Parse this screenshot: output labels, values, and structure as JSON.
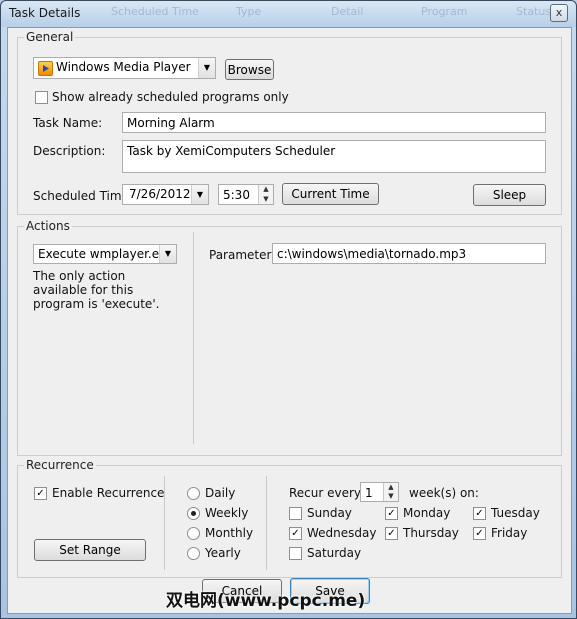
{
  "window": {
    "title": "Task Details",
    "close_glyph": "x",
    "ghost_headers": [
      "Scheduled Time",
      "Type",
      "Detail",
      "Program",
      "Status"
    ]
  },
  "general": {
    "label": "General",
    "program_select": "Windows Media Player",
    "program_icon": "media-player-icon",
    "browse_label": "Browse",
    "show_scheduled_label": "Show already scheduled programs only",
    "show_scheduled_checked": false,
    "task_name_label": "Task Name:",
    "task_name_value": "Morning Alarm",
    "description_label": "Description:",
    "description_value": "Task by XemiComputers Scheduler",
    "scheduled_time_label": "Scheduled Time:",
    "date_value": "7/26/2012",
    "time_value": "5:30",
    "current_time_label": "Current Time",
    "sleep_label": "Sleep"
  },
  "actions": {
    "label": "Actions",
    "action_select": "Execute wmplayer.exe",
    "note": "The only action available for this program is 'execute'.",
    "parameters_label": "Parameters:",
    "parameters_value": "c:\\windows\\media\\tornado.mp3"
  },
  "recurrence": {
    "label": "Recurrence",
    "enable_label": "Enable Recurrence",
    "enable_checked": true,
    "set_range_label": "Set Range",
    "options": [
      {
        "label": "Daily",
        "selected": false
      },
      {
        "label": "Weekly",
        "selected": true
      },
      {
        "label": "Monthly",
        "selected": false
      },
      {
        "label": "Yearly",
        "selected": false
      }
    ],
    "recur_every_label": "Recur every",
    "recur_every_value": "1",
    "weeks_on_label": "week(s) on:",
    "days": [
      {
        "label": "Sunday",
        "checked": false
      },
      {
        "label": "Monday",
        "checked": true
      },
      {
        "label": "Tuesday",
        "checked": true
      },
      {
        "label": "Wednesday",
        "checked": true
      },
      {
        "label": "Thursday",
        "checked": true
      },
      {
        "label": "Friday",
        "checked": true
      },
      {
        "label": "Saturday",
        "checked": false
      }
    ]
  },
  "footer": {
    "cancel_label": "Cancel",
    "save_label": "Save"
  },
  "watermark": "双电网(www.pcpc.me)"
}
